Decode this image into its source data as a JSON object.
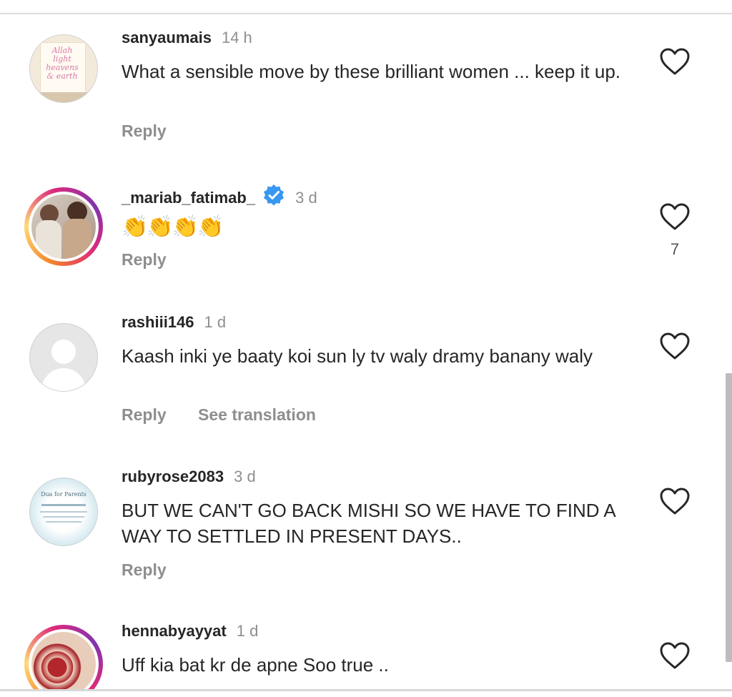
{
  "comments": [
    {
      "username": "sanyaumais",
      "time": "14 h",
      "text": "What a sensible move by these brilliant women ... keep it up.",
      "actions": [
        "Reply"
      ],
      "likes": "",
      "avatar_text": "Allah light heavens & earth"
    },
    {
      "username": "_mariab_fatimab_",
      "verified": true,
      "time": "3 d",
      "text": "👏👏👏👏",
      "actions": [
        "Reply"
      ],
      "likes": "7"
    },
    {
      "username": "rashiii146",
      "time": "1 d",
      "text": "Kaash inki ye baaty koi sun ly tv waly dramy banany waly",
      "actions": [
        "Reply",
        "See translation"
      ],
      "likes": ""
    },
    {
      "username": "rubyrose2083",
      "time": "3 d",
      "text": "BUT WE CAN'T GO BACK MISHI SO WE HAVE TO FIND A WAY TO SETTLED IN PRESENT DAYS..",
      "actions": [
        "Reply"
      ],
      "likes": "",
      "avatar_text": "Dua for Parents"
    },
    {
      "username": "hennabyayyat",
      "time": "1 d",
      "text": "Uff kia bat kr de apne Soo true ..",
      "actions": [],
      "likes": ""
    }
  ],
  "colors": {
    "verified": "#3897f0",
    "muted": "#8e8e8e",
    "text": "#262626"
  },
  "icons": {
    "like": "heart-outline-icon",
    "verified": "verified-badge-icon"
  }
}
